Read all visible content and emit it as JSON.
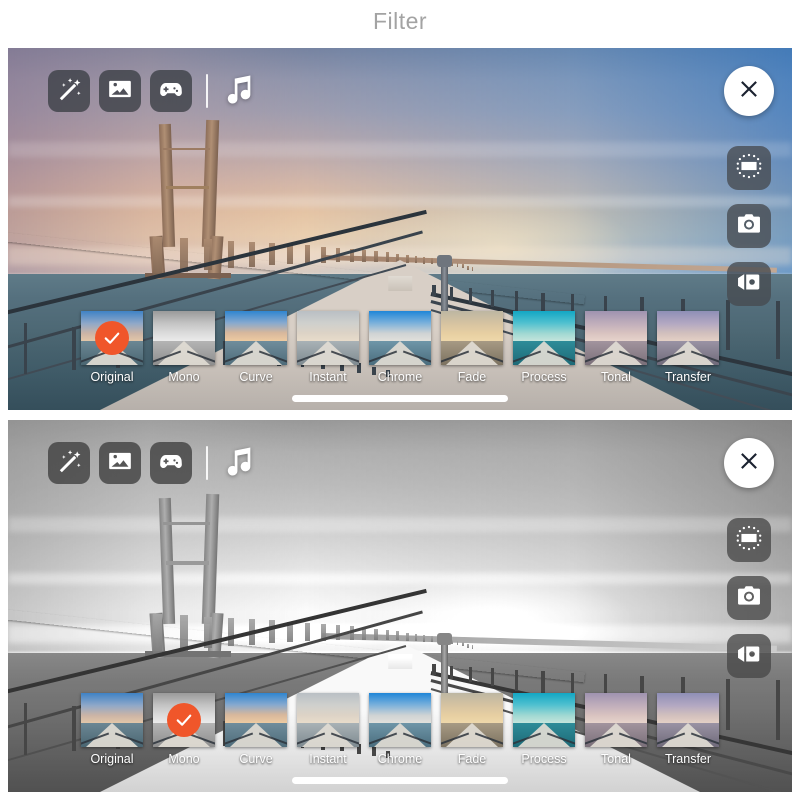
{
  "page": {
    "title": "Filter"
  },
  "toolbar": {
    "items": [
      {
        "name": "magic-wand-icon",
        "label": "Effects"
      },
      {
        "name": "photo-icon",
        "label": "Photo"
      },
      {
        "name": "game-controller-icon",
        "label": "Games"
      }
    ],
    "music_label": "Music"
  },
  "side_controls": {
    "close_label": "Close",
    "crop_label": "Crop",
    "camera_label": "Camera",
    "video_label": "Video"
  },
  "filters": [
    {
      "label": "Original",
      "sky": "linear-gradient(180deg,#3f83c6 0%,#8fa8c8 40%,#cbb4a6 72%,#e6c9a8 100%)",
      "sea": "linear-gradient(180deg,#6c8794,#4a6672)"
    },
    {
      "label": "Mono",
      "sky": "linear-gradient(180deg,#9a9a9a 0%,#c4c4c4 40%,#dcdcdc 72%,#ededed 100%)",
      "sea": "linear-gradient(180deg,#b4b4b4,#8e8e8e)"
    },
    {
      "label": "Curve",
      "sky": "linear-gradient(180deg,#2f86d0 0%,#86a9cf 38%,#d7b79c 70%,#f0cda2 100%)",
      "sea": "linear-gradient(180deg,#708d9c,#4e6c7a)"
    },
    {
      "label": "Instant",
      "sky": "linear-gradient(180deg,#b9bfc4 0%,#cfd0cd 40%,#ddd3c6 72%,#e9ddcb 100%)",
      "sea": "linear-gradient(180deg,#a9b2b6,#7e8a90)"
    },
    {
      "label": "Chrome",
      "sky": "linear-gradient(180deg,#1f86d8 0%,#79b0db 38%,#cfd3d4 72%,#e4e2dc 100%)",
      "sea": "linear-gradient(180deg,#6f96a8,#4a6d7e)"
    },
    {
      "label": "Fade",
      "sky": "linear-gradient(180deg,#bdb6a2 0%,#d6c3a1 40%,#e7cfa2 72%,#efd9ab 100%)",
      "sea": "linear-gradient(180deg,#a79a84,#7c7260)"
    },
    {
      "label": "Process",
      "sky": "linear-gradient(180deg,#12a7c4 0%,#4fc0cf 38%,#9fd8d2 72%,#c9e6dd 100%)",
      "sea": "linear-gradient(180deg,#2e8c99,#1d6a77)"
    },
    {
      "label": "Tonal",
      "sky": "linear-gradient(180deg,#9f93b0 0%,#c0aebb 40%,#d9c3c0 72%,#e8d6cd 100%)",
      "sea": "linear-gradient(180deg,#a2949e,#7a6f79)"
    },
    {
      "label": "Transfer",
      "sky": "linear-gradient(180deg,#8f8fb6 0%,#b3a8c2 40%,#d2c0bd 72%,#e6d2c6 100%)",
      "sea": "linear-gradient(180deg,#9a93a4,#6f6a7a)"
    }
  ],
  "panels": [
    {
      "id": "panel-top",
      "selected_filter": "Original",
      "mono": false
    },
    {
      "id": "panel-bottom",
      "selected_filter": "Mono",
      "mono": true
    }
  ],
  "colors": {
    "accent_check": "#f0562a",
    "title_text": "#a3a3a3",
    "chip_background": "#3c4046",
    "close_background": "#ffffff",
    "home_indicator": "#ffffff"
  }
}
